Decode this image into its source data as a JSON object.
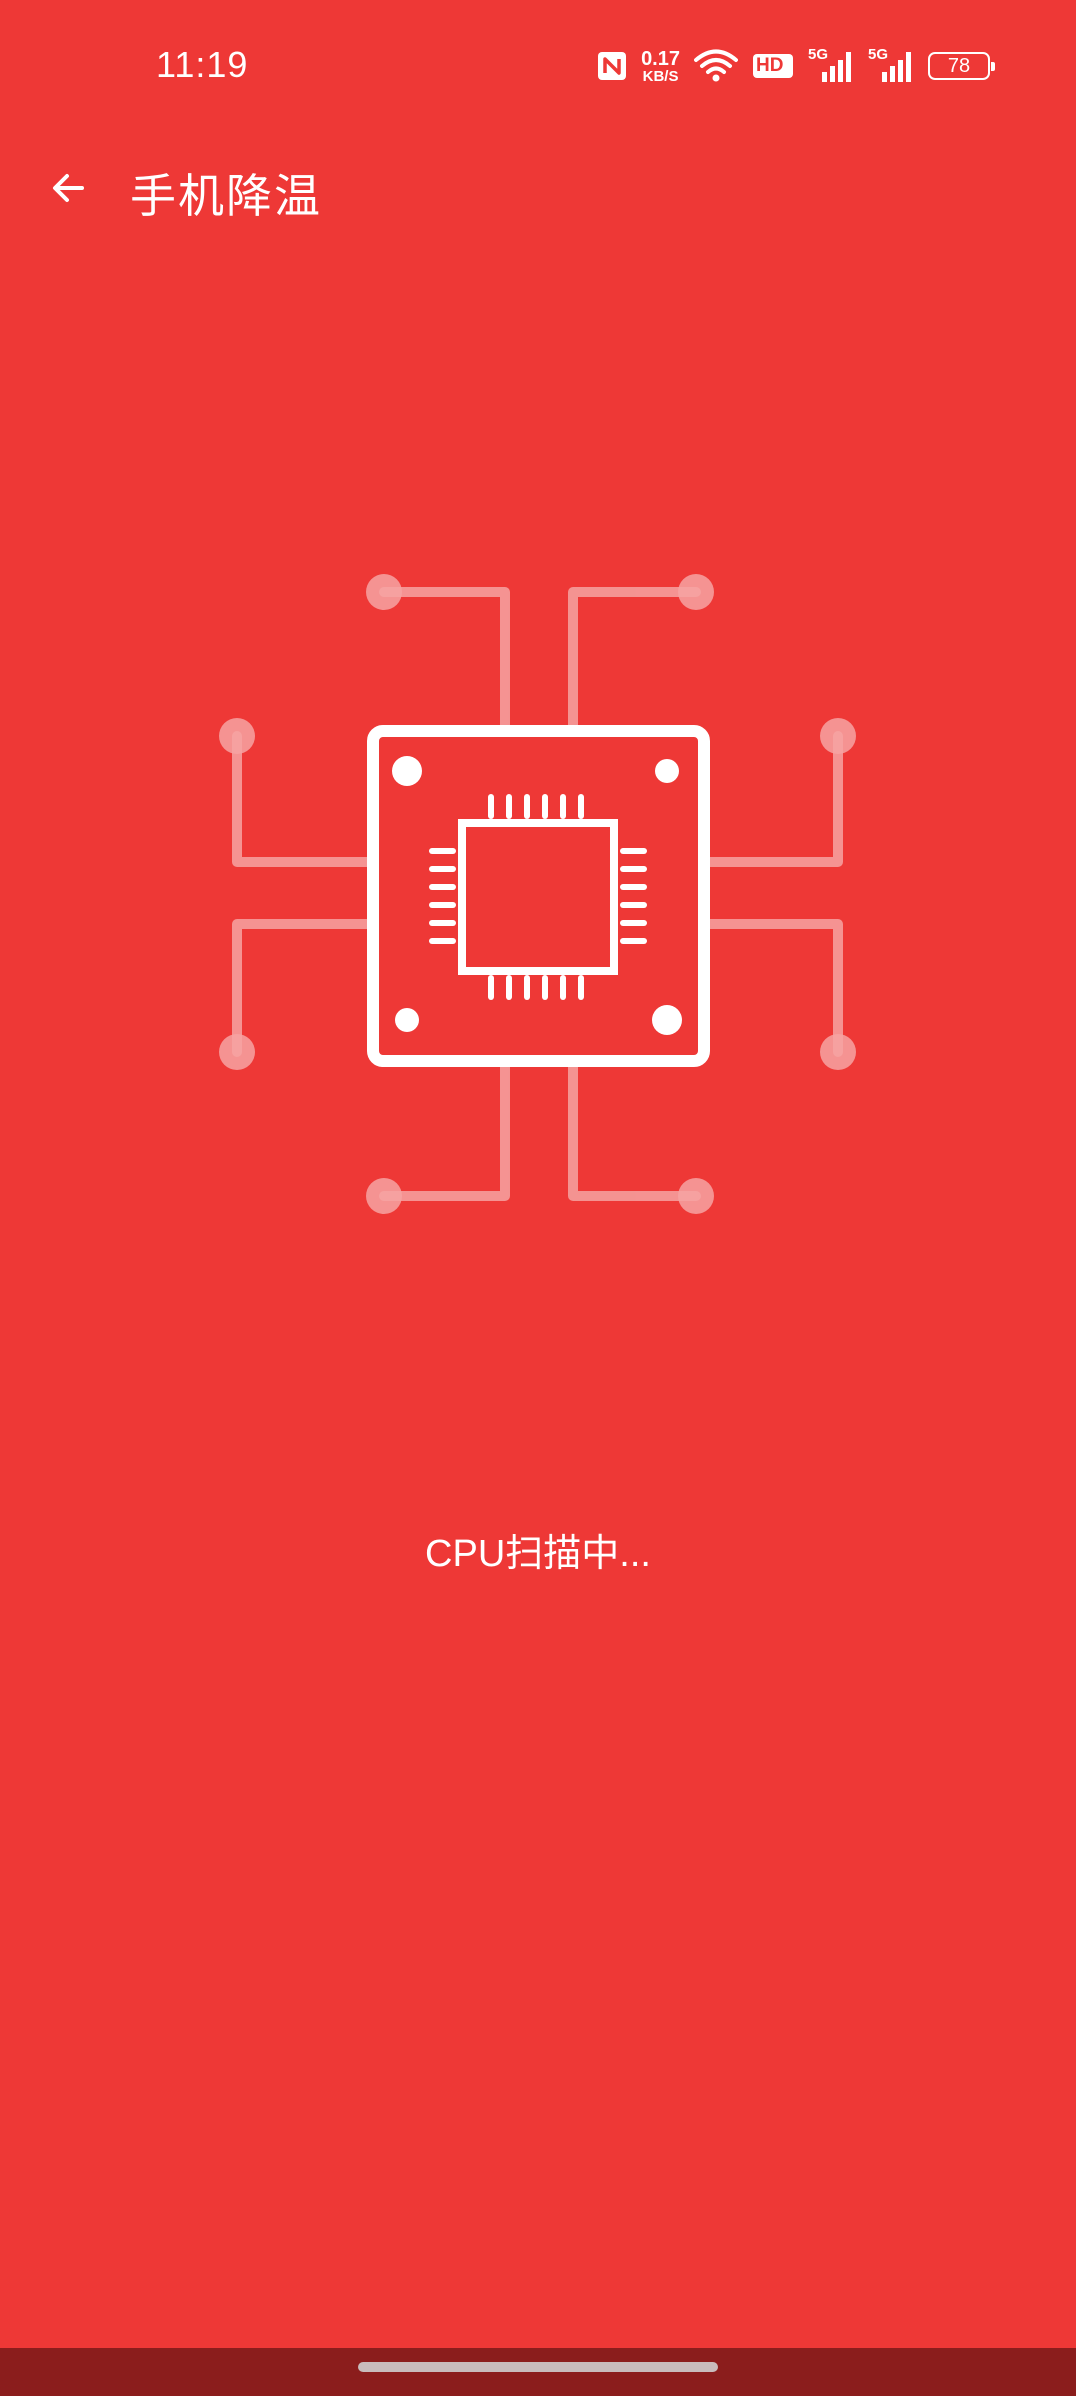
{
  "status_bar": {
    "time": "11:19",
    "net_speed_value": "0.17",
    "net_speed_unit": "KB/S",
    "hd_label": "HD",
    "signal1_label": "5G",
    "signal2_label": "5G",
    "battery_level": "78",
    "icons": [
      "nfc-icon",
      "wifi-icon",
      "hd-icon",
      "signal-5g-icon",
      "signal-5g-icon",
      "battery-icon"
    ]
  },
  "app_bar": {
    "back_icon": "arrow-left-icon",
    "title": "手机降温"
  },
  "illustration": {
    "icon": "cpu-chip-icon"
  },
  "scan": {
    "status_text": "CPU扫描中..."
  },
  "colors": {
    "background": "#ee3836",
    "foreground": "#ffffff",
    "nav_bar": "#8b1d1c"
  }
}
